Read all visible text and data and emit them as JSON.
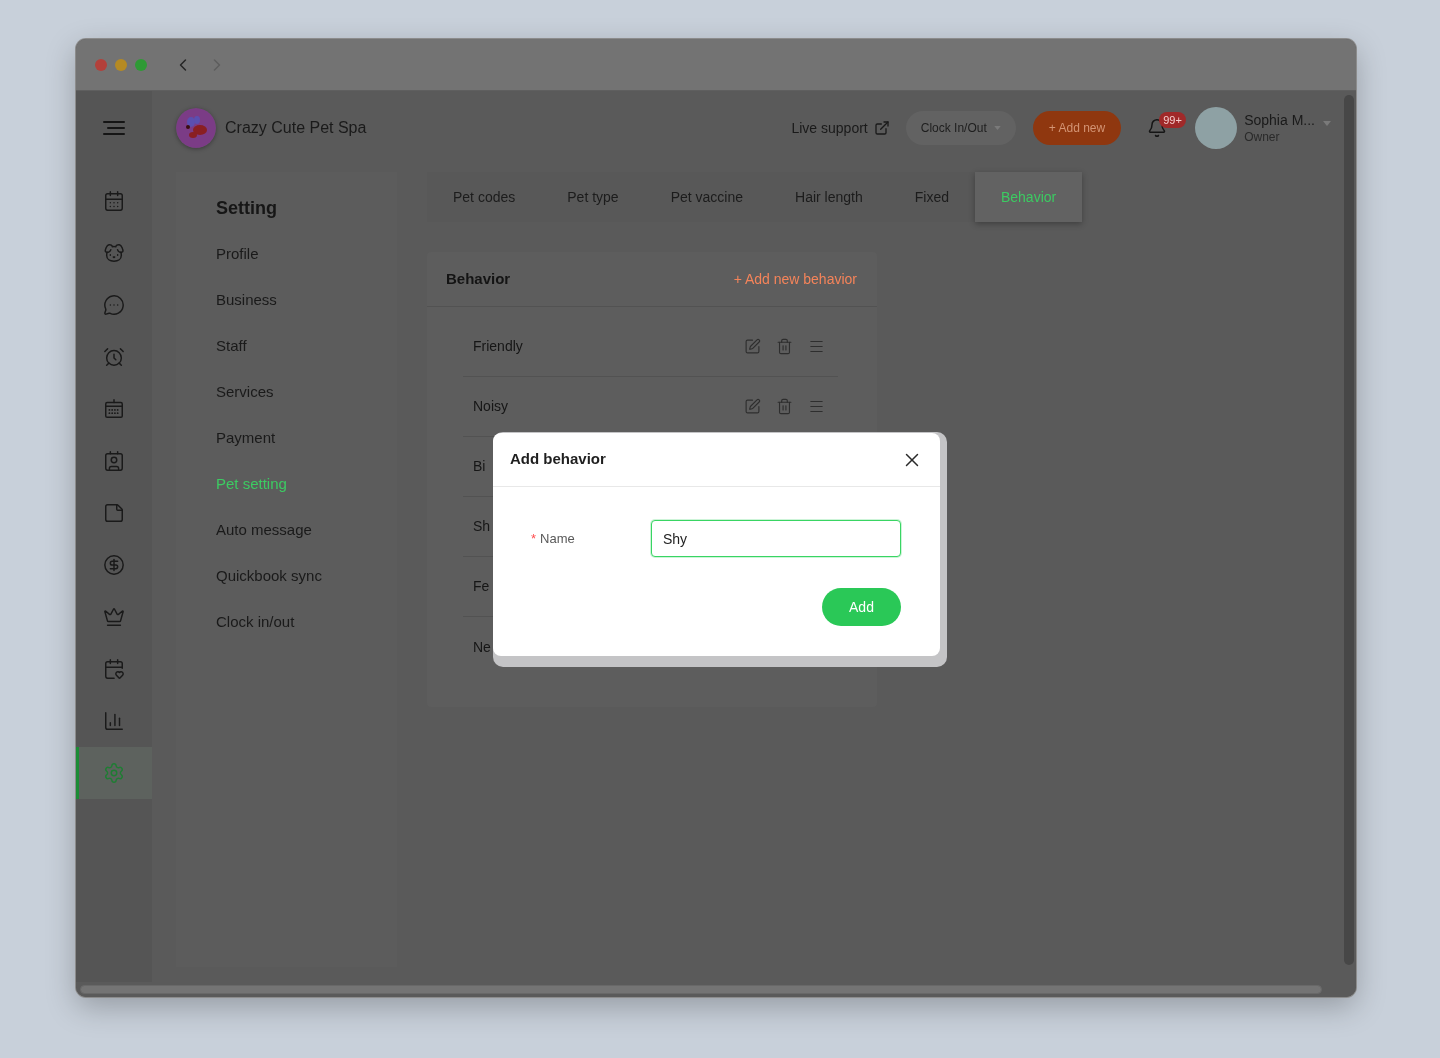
{
  "browser": {
    "nav_buttons": [
      {
        "kind": "back",
        "disabled": false
      },
      {
        "kind": "forward",
        "disabled": true
      }
    ]
  },
  "sidebar": {
    "items": [
      {
        "kind": "calendar",
        "selected": false
      },
      {
        "kind": "dog",
        "selected": false
      },
      {
        "kind": "chat",
        "selected": false
      },
      {
        "kind": "alarm",
        "selected": false
      },
      {
        "kind": "schedule",
        "selected": false
      },
      {
        "kind": "badge",
        "selected": false
      },
      {
        "kind": "note",
        "selected": false
      },
      {
        "kind": "dollar",
        "selected": false
      },
      {
        "kind": "crown",
        "selected": false
      },
      {
        "kind": "calendar_heart",
        "selected": false
      },
      {
        "kind": "chart",
        "selected": false
      },
      {
        "kind": "settings",
        "selected": true
      }
    ]
  },
  "header": {
    "business_name": "Crazy Cute Pet Spa",
    "live_support": "Live support",
    "clock_button": "Clock In/Out",
    "add_button": "+ Add new",
    "notification_count": "99+",
    "user": {
      "name": "Sophia M...",
      "role": "Owner"
    }
  },
  "settings_menu": {
    "title": "Setting",
    "items": [
      {
        "label": "Profile",
        "selected": false
      },
      {
        "label": "Business",
        "selected": false
      },
      {
        "label": "Staff",
        "selected": false
      },
      {
        "label": "Services",
        "selected": false
      },
      {
        "label": "Payment",
        "selected": false
      },
      {
        "label": "Pet setting",
        "selected": true
      },
      {
        "label": "Auto message",
        "selected": false
      },
      {
        "label": "Quickbook sync",
        "selected": false
      },
      {
        "label": "Clock in/out",
        "selected": false
      }
    ]
  },
  "tabs": [
    {
      "label": "Pet codes",
      "selected": false
    },
    {
      "label": "Pet type",
      "selected": false
    },
    {
      "label": "Pet vaccine",
      "selected": false
    },
    {
      "label": "Hair length",
      "selected": false
    },
    {
      "label": "Fixed",
      "selected": false
    },
    {
      "label": "Behavior",
      "selected": true
    }
  ],
  "behavior_card": {
    "title": "Behavior",
    "add_link": "+ Add new behavior",
    "rows": [
      {
        "kind": "full",
        "label": "Friendly"
      },
      {
        "kind": "full",
        "label": "Noisy"
      },
      {
        "kind": "cut",
        "label": "Bi"
      },
      {
        "kind": "cut",
        "label": "Sh"
      },
      {
        "kind": "cut",
        "label": "Fe"
      },
      {
        "kind": "cut",
        "label": "Ne"
      }
    ]
  },
  "modal": {
    "title": "Add behavior",
    "field": {
      "required_mark": "*",
      "label": "Name",
      "value": "Shy",
      "focused": true
    },
    "submit_button": "Add"
  }
}
